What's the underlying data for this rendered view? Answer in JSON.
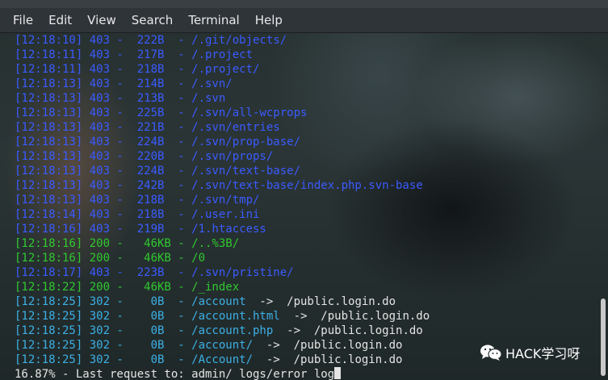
{
  "menu": [
    "File",
    "Edit",
    "View",
    "Search",
    "Terminal",
    "Help"
  ],
  "colors": {
    "blue": "#3b5bff",
    "cyan": "#3cb0e6",
    "green": "#2fc92f",
    "white": "#e4e4e4"
  },
  "lines": [
    {
      "text": "[12:18:10] 403 -  222B  - /.git/objects/",
      "color": "blue"
    },
    {
      "text": "[12:18:11] 403 -  217B  - /.project",
      "color": "blue"
    },
    {
      "text": "[12:18:11] 403 -  218B  - /.project/",
      "color": "blue"
    },
    {
      "text": "[12:18:13] 403 -  214B  - /.svn/",
      "color": "blue"
    },
    {
      "text": "[12:18:13] 403 -  213B  - /.svn",
      "color": "blue"
    },
    {
      "text": "[12:18:13] 403 -  225B  - /.svn/all-wcprops",
      "color": "blue"
    },
    {
      "text": "[12:18:13] 403 -  221B  - /.svn/entries",
      "color": "blue"
    },
    {
      "text": "[12:18:13] 403 -  224B  - /.svn/prop-base/",
      "color": "blue"
    },
    {
      "text": "[12:18:13] 403 -  220B  - /.svn/props/",
      "color": "blue"
    },
    {
      "text": "[12:18:13] 403 -  224B  - /.svn/text-base/",
      "color": "blue"
    },
    {
      "text": "[12:18:13] 403 -  242B  - /.svn/text-base/index.php.svn-base",
      "color": "blue"
    },
    {
      "text": "[12:18:13] 403 -  218B  - /.svn/tmp/",
      "color": "blue"
    },
    {
      "text": "[12:18:14] 403 -  218B  - /.user.ini",
      "color": "blue"
    },
    {
      "text": "[12:18:16] 403 -  219B  - /1.htaccess",
      "color": "blue"
    },
    {
      "text": "[12:18:16] 200 -   46KB - /..%3B/",
      "color": "green"
    },
    {
      "text": "[12:18:16] 200 -   46KB - /0",
      "color": "green"
    },
    {
      "text": "[12:18:17] 403 -  223B  - /.svn/pristine/",
      "color": "blue"
    },
    {
      "text": "[12:18:22] 200 -   46KB - /_index",
      "color": "green"
    },
    {
      "prefix": "[12:18:25] 302 -    0B  - /account",
      "suffix": "  ->  /public.login.do",
      "color": "cyan"
    },
    {
      "prefix": "[12:18:25] 302 -    0B  - /account.html",
      "suffix": "  ->  /public.login.do",
      "color": "cyan"
    },
    {
      "prefix": "[12:18:25] 302 -    0B  - /account.php",
      "suffix": "  ->  /public.login.do",
      "color": "cyan"
    },
    {
      "prefix": "[12:18:25] 302 -    0B  - /account/",
      "suffix": "  ->  /public.login.do",
      "color": "cyan"
    },
    {
      "prefix": "[12:18:25] 302 -    0B  - /Account/",
      "suffix": "  ->  /public.login.do",
      "color": "cyan"
    }
  ],
  "status_line": "16.87% - Last request to: admin/_logs/error_log",
  "watermark": {
    "icon": "wechat-icon",
    "text": "HACK学习呀"
  }
}
